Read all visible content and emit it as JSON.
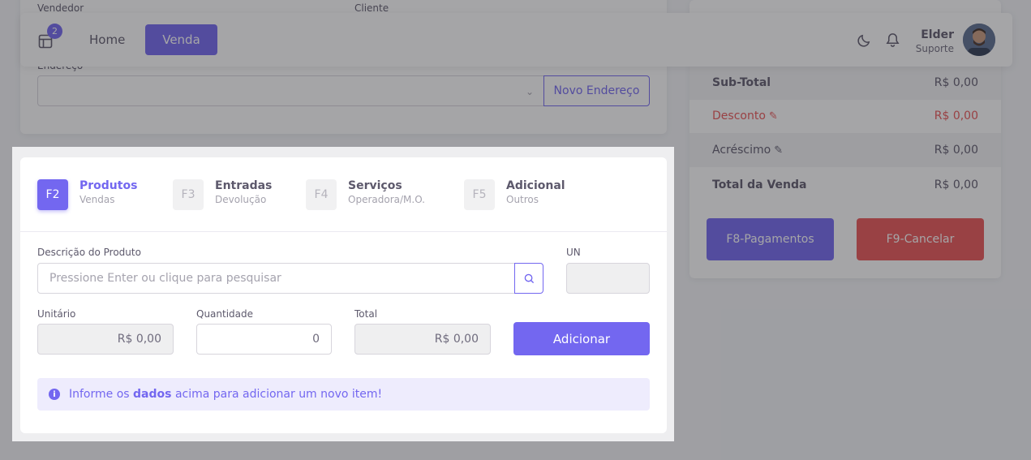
{
  "top_form": {
    "vendedor_label": "Vendedor",
    "cliente_label": "Cliente",
    "endereco_label": "Endereço",
    "novo_endereco_button": "Novo Endereço"
  },
  "navbar": {
    "badge_count": "2",
    "home_label": "Home",
    "venda_label": "Venda",
    "user_name": "Elder",
    "user_role": "Suporte"
  },
  "summary": {
    "rows": [
      {
        "label": "Sub-Total",
        "value": "R$ 0,00"
      },
      {
        "label": "Desconto",
        "value": "R$ 0,00"
      },
      {
        "label": "Acréscimo",
        "value": "R$ 0,00"
      },
      {
        "label": "Total da Venda",
        "value": "R$ 0,00"
      }
    ],
    "pay_button": "F8-Pagamentos",
    "cancel_button": "F9-Cancelar",
    "discount_color": "#ea5455"
  },
  "tabs": [
    {
      "key": "F2",
      "title": "Produtos",
      "subtitle": "Vendas",
      "active": true
    },
    {
      "key": "F3",
      "title": "Entradas",
      "subtitle": "Devolução",
      "active": false
    },
    {
      "key": "F4",
      "title": "Serviços",
      "subtitle": "Operadora/M.O.",
      "active": false
    },
    {
      "key": "F5",
      "title": "Adicional",
      "subtitle": "Outros",
      "active": false
    }
  ],
  "product_form": {
    "descricao_label": "Descrição do Produto",
    "descricao_placeholder": "Pressione Enter ou clique para pesquisar",
    "un_label": "UN",
    "unitario_label": "Unitário",
    "unitario_value": "R$ 0,00",
    "quantidade_label": "Quantidade",
    "quantidade_value": "0",
    "total_label": "Total",
    "total_value": "R$ 0,00",
    "add_button": "Adicionar"
  },
  "alert": {
    "prefix": "Informe os",
    "bold": "dados",
    "suffix": "acima para adicionar um novo item!"
  },
  "colors": {
    "accent": "#7367f0",
    "danger": "#ea5455"
  }
}
